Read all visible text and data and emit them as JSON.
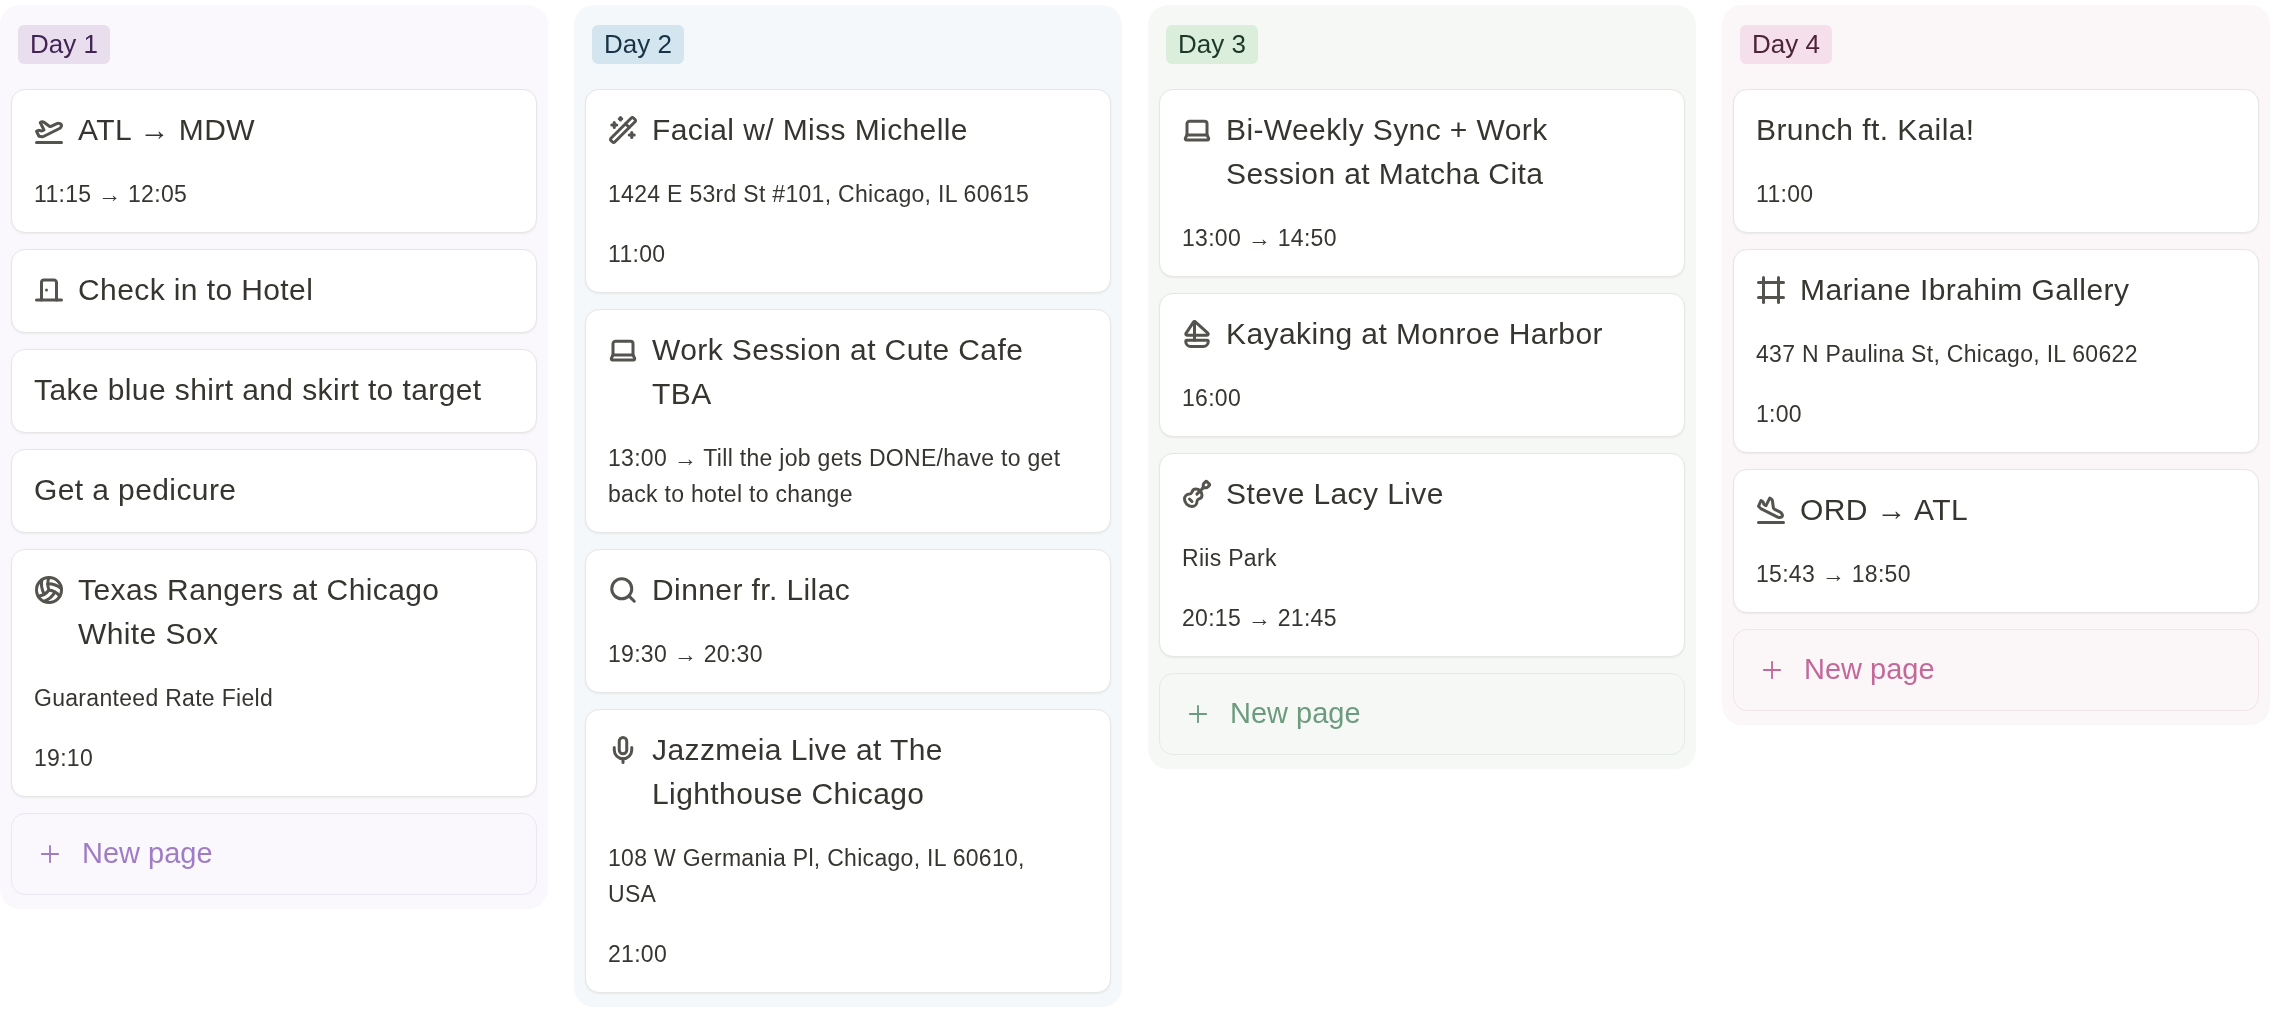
{
  "columns": [
    {
      "label": "Day 1",
      "color": "#e8deee",
      "cards": [
        {
          "kind": "departure",
          "title": "ATL → MDW",
          "lines": [
            "11:15 → 12:05"
          ]
        },
        {
          "kind": "hotel",
          "title": "Check in to Hotel"
        },
        {
          "kind": "task",
          "title": "Take blue shirt and skirt to target"
        },
        {
          "kind": "task",
          "title": "Get a pedicure"
        },
        {
          "kind": "game",
          "title": "Texas Rangers at Chicago White Sox",
          "lines": [
            "Guaranteed Rate Field",
            "19:10"
          ]
        }
      ],
      "new_page": "New page"
    },
    {
      "label": "Day 2",
      "color": "#d3e5ef",
      "cards": [
        {
          "kind": "beauty",
          "title": "Facial w/ Miss Michelle",
          "lines": [
            "1424 E 53rd St #101, Chicago, IL 60615",
            "11:00"
          ]
        },
        {
          "kind": "work",
          "title": "Work Session at Cute Cafe TBA",
          "lines": [
            "13:00 → Till the job gets DONE/have to get back to hotel to change"
          ]
        },
        {
          "kind": "dinner",
          "title": "Dinner fr. Lilac",
          "lines": [
            "19:30 → 20:30"
          ]
        },
        {
          "kind": "concert",
          "title": "Jazzmeia Live at The Lighthouse Chicago",
          "lines": [
            "108 W Germania Pl, Chicago, IL 60610, USA",
            "21:00"
          ]
        }
      ]
    },
    {
      "label": "Day 3",
      "color": "#dbeddb",
      "cards": [
        {
          "kind": "work",
          "title": "Bi-Weekly Sync + Work Session at Matcha Cita",
          "lines": [
            "13:00 → 14:50"
          ]
        },
        {
          "kind": "outdoor",
          "title": "Kayaking at Monroe Harbor",
          "lines": [
            "16:00"
          ]
        },
        {
          "kind": "music",
          "title": "Steve Lacy Live",
          "lines": [
            "Riis Park",
            "20:15 → 21:45"
          ]
        }
      ],
      "new_page": "New page"
    },
    {
      "label": "Day 4",
      "color": "#f4dfeb",
      "cards": [
        {
          "kind": "task",
          "title": "Brunch ft. Kaila!",
          "lines": [
            "11:00"
          ]
        },
        {
          "kind": "gallery",
          "title": "Mariane Ibrahim Gallery",
          "lines": [
            "437 N Paulina St, Chicago, IL 60622",
            "1:00"
          ]
        },
        {
          "kind": "arrival",
          "title": "ORD → ATL",
          "lines": [
            "15:43 → 18:50"
          ]
        }
      ],
      "new_page": "New page"
    }
  ]
}
